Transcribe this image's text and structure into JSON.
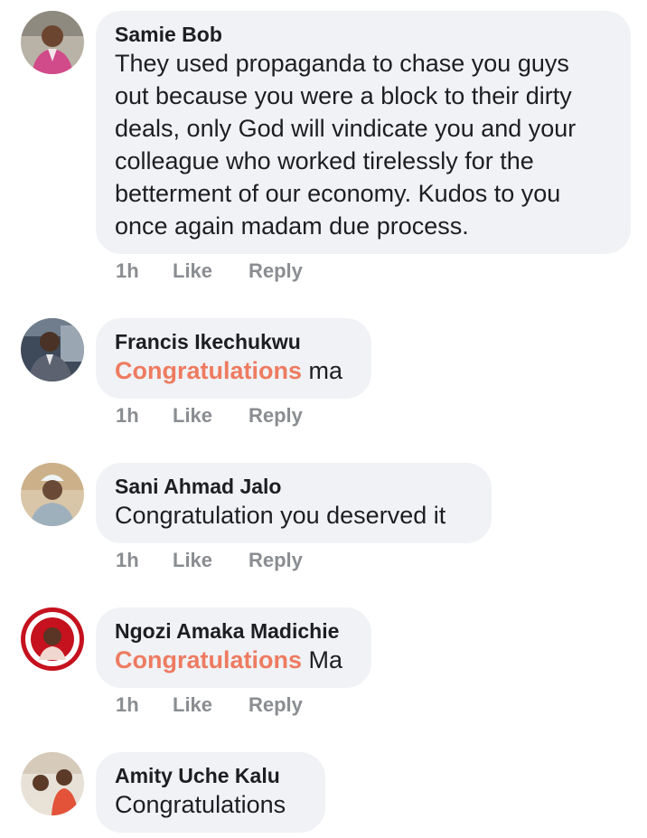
{
  "comments": [
    {
      "author": "Samie Bob",
      "text_lines": [
        "They used propaganda to chase you guys",
        "out because you were a block to their dirty",
        "deals, only God will vindicate you and your",
        "colleague who worked tirelessly for the",
        "betterment of our economy. Kudos to you",
        "once again madam due process."
      ],
      "time": "1h",
      "like_label": "Like",
      "reply_label": "Reply"
    },
    {
      "author": "Francis Ikechukwu",
      "highlight": "Congratulations",
      "text_rest": " ma",
      "time": "1h",
      "like_label": "Like",
      "reply_label": "Reply"
    },
    {
      "author": "Sani Ahmad Jalo",
      "text": "Congratulation you deserved it",
      "time": "1h",
      "like_label": "Like",
      "reply_label": "Reply"
    },
    {
      "author": "Ngozi Amaka Madichie",
      "highlight": "Congratulations",
      "text_rest": " Ma",
      "time": "1h",
      "like_label": "Like",
      "reply_label": "Reply"
    },
    {
      "author": "Amity Uche Kalu",
      "text": "Congratulations"
    }
  ],
  "colors": {
    "bubble_bg": "#f0f2f5",
    "text": "#1c1e21",
    "meta": "#8a8d91",
    "highlight": "#ee7b61"
  }
}
